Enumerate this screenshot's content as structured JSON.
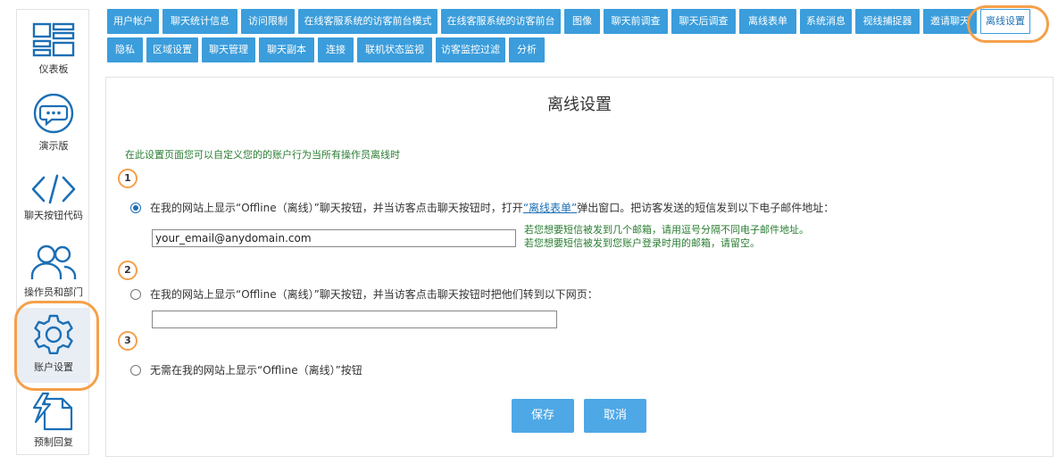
{
  "sidebar": {
    "items": [
      {
        "label": "仪表板",
        "icon": "dashboard-icon"
      },
      {
        "label": "演示版",
        "icon": "chat-bubble-icon"
      },
      {
        "label": "聊天按钮代码",
        "icon": "code-icon"
      },
      {
        "label": "操作员和部门",
        "icon": "users-icon"
      },
      {
        "label": "账户设置",
        "icon": "gear-icon"
      },
      {
        "label": "预制回复",
        "icon": "canned-reply-icon"
      }
    ]
  },
  "tabs": {
    "row1": [
      "用户帐户",
      "聊天统计信息",
      "访问限制",
      "在线客服系统的访客前台模式",
      "在线客服系统的访客前台",
      "图像",
      "聊天前调查",
      "聊天后调查",
      "离线表单",
      "系统消息",
      "视线捕捉器",
      "邀请聊天",
      "离线设置"
    ],
    "row2": [
      "隐私",
      "区域设置",
      "聊天管理",
      "聊天副本",
      "连接",
      "联机状态监视",
      "访客监控过滤",
      "分析"
    ],
    "active": "离线设置"
  },
  "panel": {
    "title": "离线设置",
    "intro": "在此设置页面您可以自定义您的的账户行为当所有操作员离线时",
    "steps": [
      "1",
      "2",
      "3"
    ],
    "option1_prefix": "在我的网站上显示“Offline（离线）”聊天按钮，并当访客点击聊天按钮时，打开",
    "option1_link": "“离线表单”",
    "option1_suffix": "弹出窗口。把访客发送的短信发到以下电子邮件地址：",
    "email_value": "your_email@anydomain.com",
    "hint1": "若您想要短信被发到几个邮箱，请用逗号分隔不同电子邮件地址。",
    "hint2": "若您想要短信被发到您账户登录时用的邮箱，请留空。",
    "option2_label": "在我的网站上显示“Offline（离线）”聊天按钮，并当访客点击聊天按钮时把他们转到以下网页：",
    "url_value": "",
    "option3_label": "无需在我的网站上显示“Offline（离线）”按钮",
    "selected_option": 1,
    "save_label": "保存",
    "cancel_label": "取消"
  },
  "colors": {
    "accent": "#3b9ddb",
    "highlight": "#f5a04a",
    "hint_green": "#2a7d32",
    "button": "#4ea8e6"
  }
}
